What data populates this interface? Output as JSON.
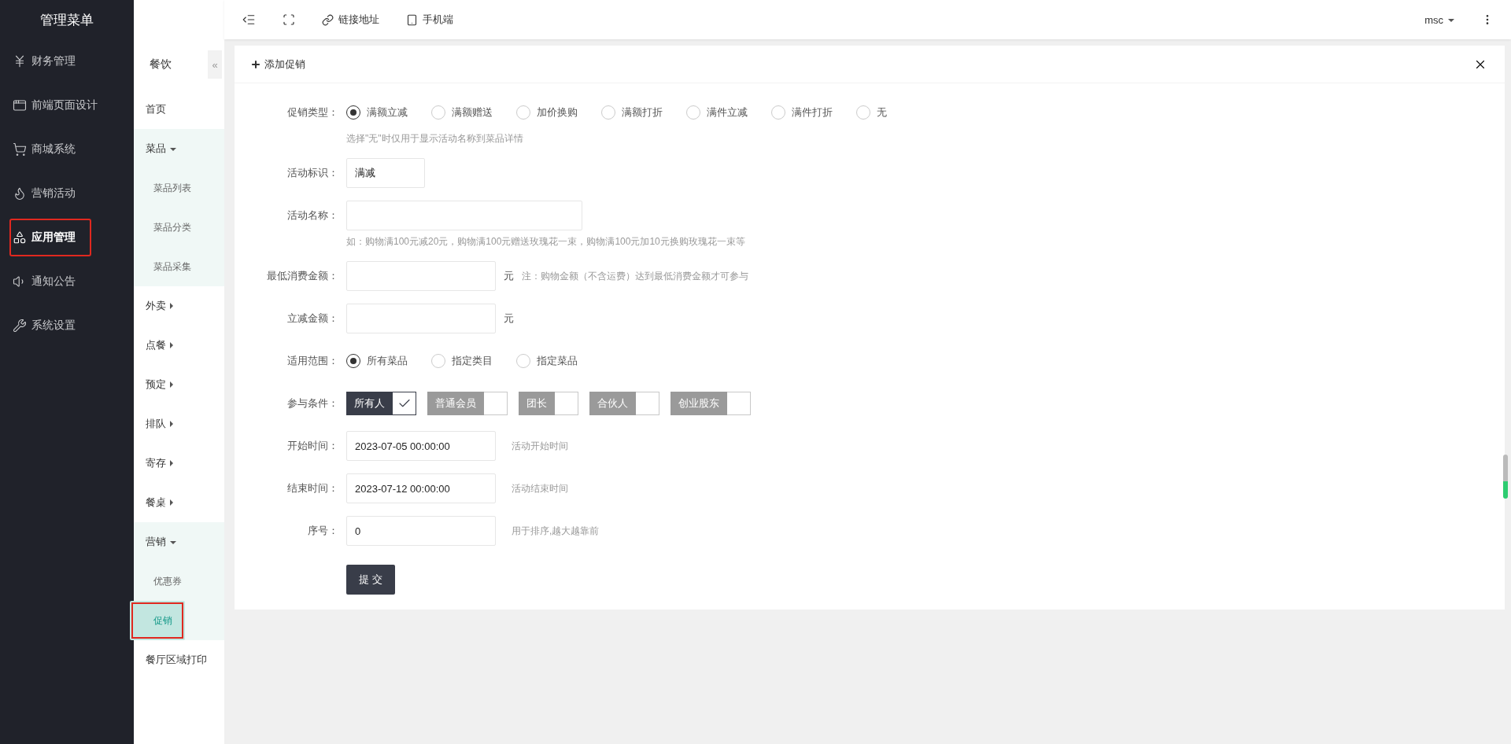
{
  "sidebar": {
    "title": "管理菜单",
    "items": [
      {
        "label": "财务管理",
        "selected": false,
        "highlighted": false
      },
      {
        "label": "前端页面设计",
        "selected": false,
        "highlighted": false
      },
      {
        "label": "商城系统",
        "selected": false,
        "highlighted": false
      },
      {
        "label": "营销活动",
        "selected": false,
        "highlighted": false
      },
      {
        "label": "应用管理",
        "selected": true,
        "highlighted": true
      },
      {
        "label": "通知公告",
        "selected": false,
        "highlighted": false
      },
      {
        "label": "系统设置",
        "selected": false,
        "highlighted": false
      }
    ]
  },
  "subnav": {
    "title": "餐饮",
    "collapse": "«",
    "items": [
      {
        "label": "首页"
      },
      {
        "label": "菜品",
        "expanded": true,
        "children": [
          {
            "label": "菜品列表",
            "selected": false,
            "highlighted": false
          },
          {
            "label": "菜品分类",
            "selected": false,
            "highlighted": false
          },
          {
            "label": "菜品采集",
            "selected": false,
            "highlighted": false
          }
        ]
      },
      {
        "label": "外卖",
        "expanded": false
      },
      {
        "label": "点餐",
        "expanded": false
      },
      {
        "label": "预定",
        "expanded": false
      },
      {
        "label": "排队",
        "expanded": false
      },
      {
        "label": "寄存",
        "expanded": false
      },
      {
        "label": "餐桌",
        "expanded": false
      },
      {
        "label": "营销",
        "expanded": true,
        "children": [
          {
            "label": "优惠券",
            "selected": false,
            "highlighted": false
          },
          {
            "label": "促销",
            "selected": true,
            "highlighted": true
          }
        ]
      },
      {
        "label": "餐厅区域打印"
      }
    ]
  },
  "topbar": {
    "links": [
      {
        "label": "链接地址"
      },
      {
        "label": "手机端"
      }
    ],
    "user": "msc"
  },
  "panel": {
    "title": "添加促销",
    "rows": [
      {
        "kind": "radio",
        "label": "促销类型：",
        "options": [
          {
            "label": "满额立减",
            "selected": true
          },
          {
            "label": "满额赠送",
            "selected": false
          },
          {
            "label": "加价换购",
            "selected": false
          },
          {
            "label": "满额打折",
            "selected": false
          },
          {
            "label": "满件立减",
            "selected": false
          },
          {
            "label": "满件打折",
            "selected": false
          },
          {
            "label": "无",
            "selected": false
          }
        ],
        "hint": "选择\"无\"时仅用于显示活动名称到菜品详情"
      },
      {
        "kind": "shortinput",
        "label": "活动标识：",
        "value": "满减"
      },
      {
        "kind": "wideinput",
        "label": "活动名称：",
        "hint": "如：购物满100元减20元，购物满100元赠送玫瑰花一束，购物满100元加10元换购玫瑰花一束等"
      },
      {
        "kind": "input",
        "label": "最低消费金额：",
        "unit": "元",
        "note": "注：购物金额（不含运费）达到最低消费金额才可参与"
      },
      {
        "kind": "input",
        "label": "立减金额：",
        "unit": "元"
      },
      {
        "kind": "radio",
        "label": "适用范围：",
        "options": [
          {
            "label": "所有菜品",
            "selected": true
          },
          {
            "label": "指定类目",
            "selected": false
          },
          {
            "label": "指定菜品",
            "selected": false
          }
        ]
      },
      {
        "kind": "toggles",
        "label": "参与条件：",
        "options": [
          {
            "label": "所有人",
            "checked": true
          },
          {
            "label": "普通会员",
            "checked": false
          },
          {
            "label": "团长",
            "checked": false
          },
          {
            "label": "合伙人",
            "checked": false
          },
          {
            "label": "创业股东",
            "checked": false
          }
        ]
      },
      {
        "kind": "input",
        "label": "开始时间：",
        "value": "2023-07-05 00:00:00",
        "note": "活动开始时间"
      },
      {
        "kind": "input",
        "label": "结束时间：",
        "value": "2023-07-12 00:00:00",
        "note": "活动结束时间"
      },
      {
        "kind": "input",
        "label": "序号：",
        "value": "0",
        "note": "用于排序,越大越靠前"
      },
      {
        "kind": "submit",
        "label": "提 交"
      }
    ]
  }
}
